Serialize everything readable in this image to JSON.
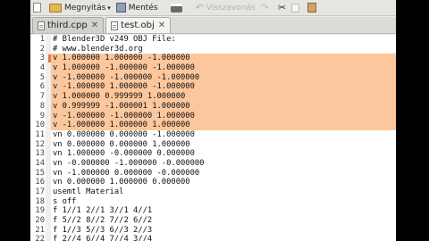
{
  "toolbar": {
    "open_label": "Megnyitás",
    "save_label": "Mentés",
    "undo_label": "Visszavonás"
  },
  "tabs": [
    {
      "label": "third.cpp",
      "active": false
    },
    {
      "label": "test.obj",
      "active": true
    }
  ],
  "editor": {
    "lines": [
      {
        "n": "1",
        "text": "# Blender3D v249 OBJ File:",
        "sel": false
      },
      {
        "n": "2",
        "text": "# www.blender3d.org",
        "sel": false
      },
      {
        "n": "3",
        "text": "v 1.000000 1.000000 -1.000000",
        "sel": true
      },
      {
        "n": "4",
        "text": "v 1.000000 -1.000000 -1.000000",
        "sel": true
      },
      {
        "n": "5",
        "text": "v -1.000000 -1.000000 -1.000000",
        "sel": true
      },
      {
        "n": "6",
        "text": "v -1.000000 1.000000 -1.000000",
        "sel": true
      },
      {
        "n": "7",
        "text": "v 1.000000 0.999999 1.000000",
        "sel": true
      },
      {
        "n": "8",
        "text": "v 0.999999 -1.000001 1.000000",
        "sel": true
      },
      {
        "n": "9",
        "text": "v -1.000000 -1.000000 1.000000",
        "sel": true
      },
      {
        "n": "10",
        "text": "v -1.000000 1.000000 1.000000",
        "sel": true
      },
      {
        "n": "11",
        "text": "vn 0.000000 0.000000 -1.000000",
        "sel": false
      },
      {
        "n": "12",
        "text": "vn 0.000000 0.000000 1.000000",
        "sel": false
      },
      {
        "n": "13",
        "text": "vn 1.000000 -0.000000 0.000000",
        "sel": false
      },
      {
        "n": "14",
        "text": "vn -0.000000 -1.000000 -0.000000",
        "sel": false
      },
      {
        "n": "15",
        "text": "vn -1.000000 0.000000 -0.000000",
        "sel": false
      },
      {
        "n": "16",
        "text": "vn 0.000000 1.000000 0.000000",
        "sel": false
      },
      {
        "n": "17",
        "text": "usemtl Material",
        "sel": false
      },
      {
        "n": "18",
        "text": "s off",
        "sel": false
      },
      {
        "n": "19",
        "text": "f 1//1 2//1 3//1 4//1",
        "sel": false
      },
      {
        "n": "20",
        "text": "f 5//2 8//2 7//2 6//2",
        "sel": false
      },
      {
        "n": "21",
        "text": "f 1//3 5//3 6//3 2//3",
        "sel": false
      },
      {
        "n": "22",
        "text": "f 2//4 6//4 7//4 3//4",
        "sel": false
      }
    ]
  },
  "colors": {
    "selection": "#fcc79c",
    "cursor_marker": "#e07a3a"
  }
}
